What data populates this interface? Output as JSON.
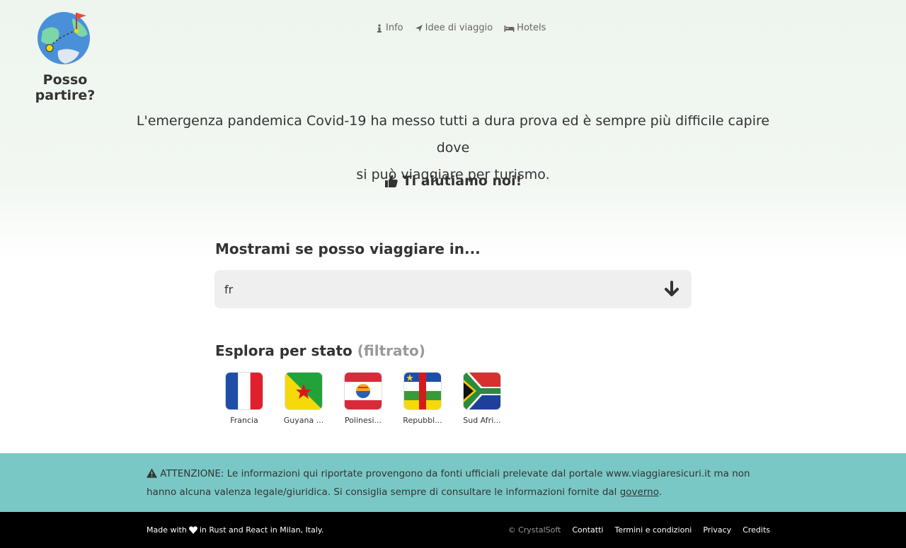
{
  "site": {
    "title": "Posso partire?"
  },
  "nav": [
    {
      "label": "Info",
      "icon": "info-icon"
    },
    {
      "label": "Idee di viaggio",
      "icon": "plane-icon"
    },
    {
      "label": "Hotels",
      "icon": "bed-icon"
    }
  ],
  "intro": {
    "line1": "L'emergenza pandemica Covid-19 ha messo tutti a dura prova ed è sempre più difficile capire dove",
    "line2": "si può viaggiare per turismo.",
    "help": "Ti aiutiamo noi!"
  },
  "search": {
    "title": "Mostrami se posso viaggiare in...",
    "value": "fr"
  },
  "explore": {
    "title": "Esplora per stato",
    "filtered": "(filtrato)",
    "countries": [
      {
        "label": "Francia"
      },
      {
        "label": "Guyana ..."
      },
      {
        "label": "Polinesi..."
      },
      {
        "label": "Repubbl..."
      },
      {
        "label": "Sud Afri..."
      }
    ]
  },
  "notice": {
    "prefix": "ATTENZIONE:",
    "text": "Le informazioni qui riportate provengono da fonti ufficiali prelevate dal portale www.viaggiaresicuri.it ma non hanno alcuna valenza legale/giuridica. Si consiglia sempre di consultare le informazioni fornite dal",
    "link": "governo",
    "suffix": "."
  },
  "footer": {
    "made_prefix": "Made with",
    "made_suffix": "in Rust and React in Milan, Italy.",
    "copyright": "© CrystalSoft",
    "links": [
      "Contatti",
      "Termini e condizioni",
      "Privacy",
      "Credits"
    ]
  },
  "colors": {
    "notice_bg": "#79c8c5",
    "footer_bg": "#000000",
    "search_bg": "#efefef"
  }
}
